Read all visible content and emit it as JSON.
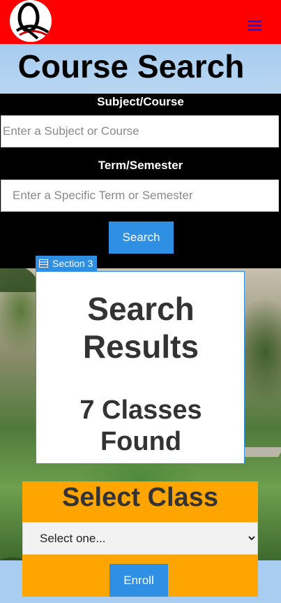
{
  "header": {
    "logo_icon": "q-logo-icon",
    "menu_icon": "hamburger-menu-icon",
    "background_color": "#ff0000",
    "menu_color": "#1b1be0"
  },
  "page": {
    "title": "Course Search"
  },
  "search_form": {
    "subject_label": "Subject/Course",
    "subject_placeholder": "Enter a Subject or Course",
    "term_label": "Term/Semester",
    "term_placeholder": "Enter a Specific Term or Semester",
    "search_button": "Search",
    "accent_color": "#2f8fe3"
  },
  "results": {
    "section_tag": "Section 3",
    "section_icon": "section-icon",
    "title": "Search Results",
    "count_text": "7 Classes Found"
  },
  "enroll": {
    "title": "Select Class",
    "select_value": "Select one...",
    "enroll_button": "Enroll",
    "background_color": "#ffa500"
  }
}
